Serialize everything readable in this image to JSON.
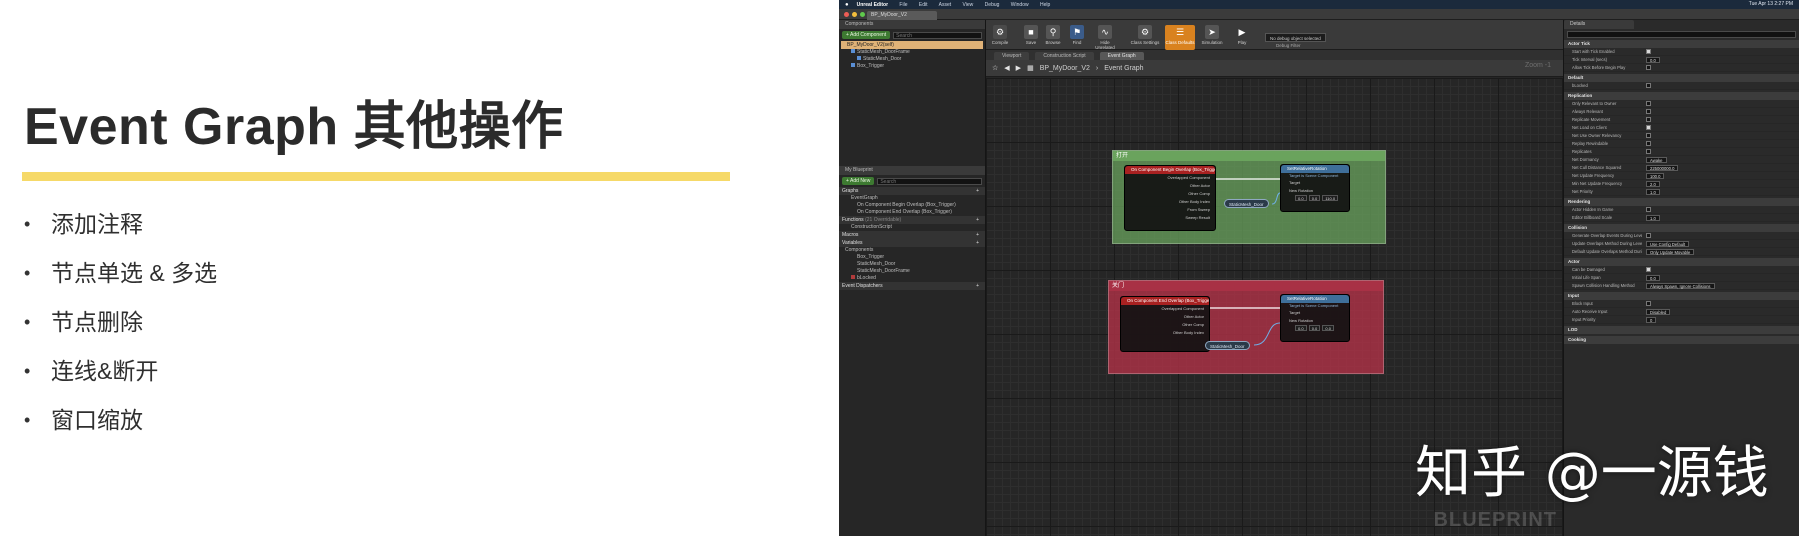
{
  "slide": {
    "title": "Event Graph 其他操作",
    "accent_color": "#f6d968",
    "bullet_symbol": "•",
    "bullets": [
      "添加注释",
      "节点单选 & 多选",
      "节点删除",
      "连线&断开",
      "窗口缩放"
    ]
  },
  "editor": {
    "mac_menu": [
      "Unreal Editor",
      "File",
      "Edit",
      "Asset",
      "View",
      "Debug",
      "Window",
      "Help"
    ],
    "clock": "Tue Apr 13  2:27 PM",
    "doc_tab": "BP_MyDoor_V2",
    "components_panel": {
      "tab": "Components",
      "add_button": "+ Add Component",
      "search_placeholder": "Search",
      "selected": "BP_MyDoor_V2(self)",
      "items": [
        "StaticMesh_DoorFrame",
        "StaticMesh_Door",
        "Box_Trigger"
      ]
    },
    "my_blueprint": {
      "tab": "My Blueprint",
      "add_button": "+ Add New",
      "search_placeholder": "Search",
      "sections": {
        "graphs": "Graphs",
        "functions": "Functions",
        "macros": "Macros",
        "variables": "Variables",
        "components": "Components",
        "dispatchers": "Event Dispatchers"
      },
      "graph_items": [
        "EventGraph",
        "On Component Begin Overlap (Box_Trigger)",
        "On Component End Overlap (Box_Trigger)"
      ],
      "function_items": [
        "ConstructionScript"
      ],
      "function_count": "(21 Overridable)",
      "component_items": [
        "Box_Trigger",
        "StaticMesh_Door",
        "StaticMesh_DoorFrame"
      ],
      "variable_items": [
        "bLocked"
      ]
    },
    "toolbar": {
      "buttons": [
        "Compile",
        "Save",
        "Browse",
        "Find",
        "Hide Unrelated",
        "Class Settings",
        "Class Defaults",
        "Simulation",
        "Play"
      ],
      "debug_select": "No debug object selected",
      "debug_label": "Debug Filter"
    },
    "graph_tabs": [
      "Viewport",
      "Construction Script",
      "Event Graph"
    ],
    "breadcrumb": {
      "blueprint": "BP_MyDoor_V2",
      "separator": "›",
      "graph": "Event Graph"
    },
    "zoom": "Zoom -1",
    "comments": [
      {
        "title": "打开",
        "color": "#6aa35d",
        "event_node": "On Component Begin Overlap (Box_Trigger)",
        "event_pins": [
          "Overlapped Component",
          "Other Actor",
          "Other Comp",
          "Other Body Index",
          "From Sweep",
          "Sweep Result"
        ],
        "set_node": "SetRelativeRotation",
        "set_sub": "Target is Scene Component",
        "set_pins": [
          "Target",
          "New Rotation"
        ],
        "values": [
          "0.0",
          "0.0",
          "110.0"
        ],
        "var_node": "StaticMesh_Door"
      },
      {
        "title": "关门",
        "color": "#a83145",
        "event_node": "On Component End Overlap (Box_Trigger)",
        "event_pins": [
          "Overlapped Component",
          "Other Actor",
          "Other Comp",
          "Other Body Index"
        ],
        "set_node": "SetRelativeRotation",
        "set_sub": "Target is Scene Component",
        "set_pins": [
          "Target",
          "New Rotation"
        ],
        "values": [
          "0.0",
          "0.0",
          "0.0"
        ],
        "var_node": "StaticMesh_Door"
      }
    ],
    "graph_watermark": "BLUEPRINT",
    "details": {
      "tab": "Details",
      "search_placeholder": "Search Details",
      "categories": [
        {
          "name": "Actor Tick",
          "rows": [
            {
              "k": "Start with Tick Enabled",
              "v": "check-on"
            },
            {
              "k": "Tick Interval (secs)",
              "v": "0.0"
            },
            {
              "k": "Allow Tick Before Begin Play",
              "v": "check-off"
            }
          ]
        },
        {
          "name": "Default",
          "rows": [
            {
              "k": "bLocked",
              "v": "check-off"
            }
          ]
        },
        {
          "name": "Replication",
          "rows": [
            {
              "k": "Only Relevant to Owner",
              "v": "check-off"
            },
            {
              "k": "Always Relevant",
              "v": "check-off"
            },
            {
              "k": "Replicate Movement",
              "v": "check-off"
            },
            {
              "k": "Net Load on Client",
              "v": "check-on"
            },
            {
              "k": "Net Use Owner Relevancy",
              "v": "check-off"
            },
            {
              "k": "Replay Rewindable",
              "v": "check-off"
            },
            {
              "k": "Replicates",
              "v": "check-off"
            },
            {
              "k": "Net Dormancy",
              "v": "Awake"
            },
            {
              "k": "Net Cull Distance Squared",
              "v": "225000000.0"
            },
            {
              "k": "Net Update Frequency",
              "v": "100.0"
            },
            {
              "k": "Min Net Update Frequency",
              "v": "2.0"
            },
            {
              "k": "Net Priority",
              "v": "1.0"
            }
          ]
        },
        {
          "name": "Rendering",
          "rows": [
            {
              "k": "Actor Hidden In Game",
              "v": "check-off"
            },
            {
              "k": "Editor Billboard Scale",
              "v": "1.0"
            }
          ]
        },
        {
          "name": "Collision",
          "rows": [
            {
              "k": "Generate Overlap Events During Level Streaming",
              "v": "check-off"
            },
            {
              "k": "Update Overlaps Method During Level Streaming",
              "v": "Use Config Default"
            },
            {
              "k": "Default Update Overlaps Method During Level Streaming",
              "v": "Only Update Movable"
            }
          ]
        },
        {
          "name": "Actor",
          "rows": [
            {
              "k": "Can be Damaged",
              "v": "check-on"
            },
            {
              "k": "Initial Life Span",
              "v": "0.0"
            },
            {
              "k": "Spawn Collision Handling Method",
              "v": "Always Spawn, Ignore Collisions"
            }
          ]
        },
        {
          "name": "Input",
          "rows": [
            {
              "k": "Block Input",
              "v": "check-off"
            },
            {
              "k": "Auto Receive Input",
              "v": "Disabled"
            },
            {
              "k": "Input Priority",
              "v": "0"
            }
          ]
        },
        {
          "name": "LOD",
          "rows": []
        },
        {
          "name": "Cooking",
          "rows": []
        }
      ]
    }
  },
  "watermark": "知乎 @一源钱"
}
